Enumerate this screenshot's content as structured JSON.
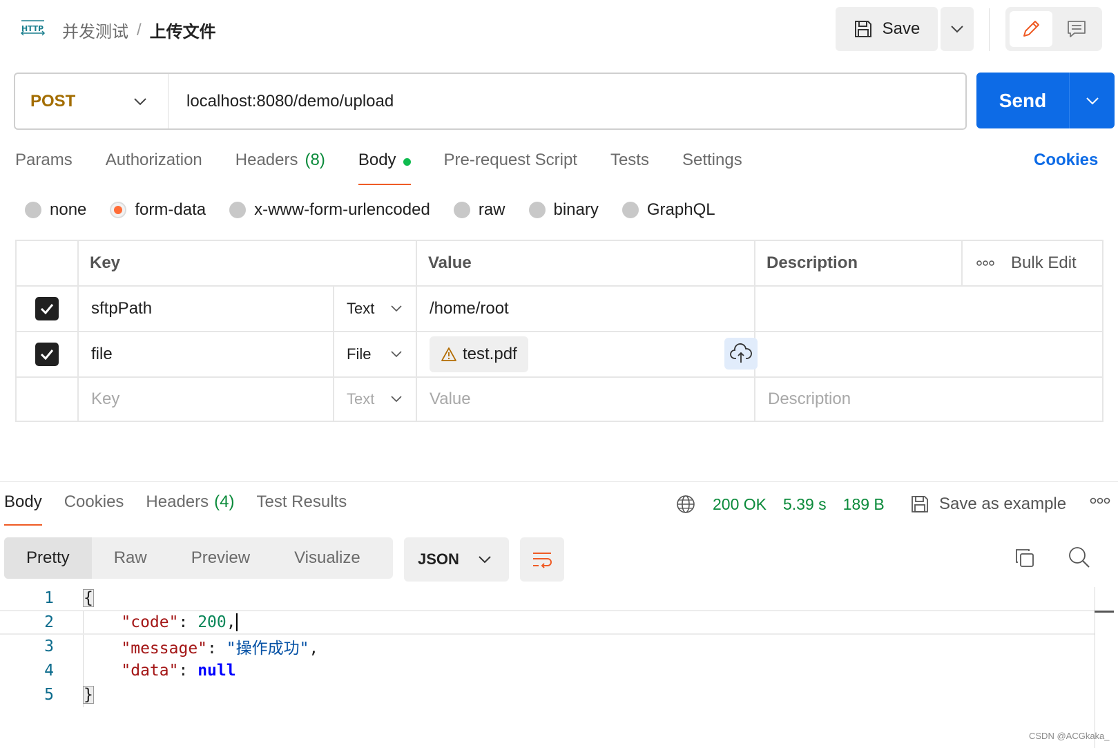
{
  "header": {
    "protocol_icon_label": "HTTP",
    "breadcrumb_parent": "并发测试",
    "breadcrumb_sep": "/",
    "breadcrumb_current": "上传文件",
    "save_label": "Save",
    "icons": [
      "http-icon",
      "save-icon",
      "chevron-down-icon",
      "pencil-icon",
      "comment-icon"
    ]
  },
  "request": {
    "method": "POST",
    "url": "localhost:8080/demo/upload",
    "send_label": "Send",
    "colors": {
      "method": "#a36d00",
      "send": "#0d6be6",
      "accent": "#ef5b25"
    }
  },
  "request_tabs": {
    "params": "Params",
    "authorization": "Authorization",
    "headers": "Headers",
    "headers_count": "(8)",
    "body": "Body",
    "pre_request": "Pre-request Script",
    "tests": "Tests",
    "settings": "Settings",
    "cookies": "Cookies",
    "active": "Body"
  },
  "body_types": {
    "none": "none",
    "form_data": "form-data",
    "urlencoded": "x-www-form-urlencoded",
    "raw": "raw",
    "binary": "binary",
    "graphql": "GraphQL",
    "selected": "form-data"
  },
  "params_table": {
    "headers": {
      "key": "Key",
      "value": "Value",
      "description": "Description",
      "bulk_edit": "Bulk Edit"
    },
    "rows": [
      {
        "checked": true,
        "key": "sftpPath",
        "type": "Text",
        "value": "/home/root",
        "description": ""
      },
      {
        "checked": true,
        "key": "file",
        "type": "File",
        "value": "test.pdf",
        "description": ""
      }
    ],
    "new_row": {
      "key_placeholder": "Key",
      "type": "Text",
      "value_placeholder": "Value",
      "description_placeholder": "Description"
    }
  },
  "response": {
    "tabs": {
      "body": "Body",
      "cookies": "Cookies",
      "headers": "Headers",
      "headers_count": "(4)",
      "test_results": "Test Results",
      "active": "Body"
    },
    "status": "200 OK",
    "time": "5.39 s",
    "size": "189 B",
    "save_example": "Save as example",
    "view_modes": {
      "pretty": "Pretty",
      "raw": "Raw",
      "preview": "Preview",
      "visualize": "Visualize",
      "active": "Pretty"
    },
    "format": "JSON",
    "code": {
      "line_numbers": [
        "1",
        "2",
        "3",
        "4",
        "5"
      ],
      "open_brace": "{",
      "close_brace": "}",
      "key_code": "\"code\"",
      "val_code": "200",
      "key_message": "\"message\"",
      "val_message": "\"操作成功\"",
      "key_data": "\"data\"",
      "val_data": "null",
      "colon": ": ",
      "comma": ","
    }
  },
  "watermark": "CSDN @ACGkaka_"
}
